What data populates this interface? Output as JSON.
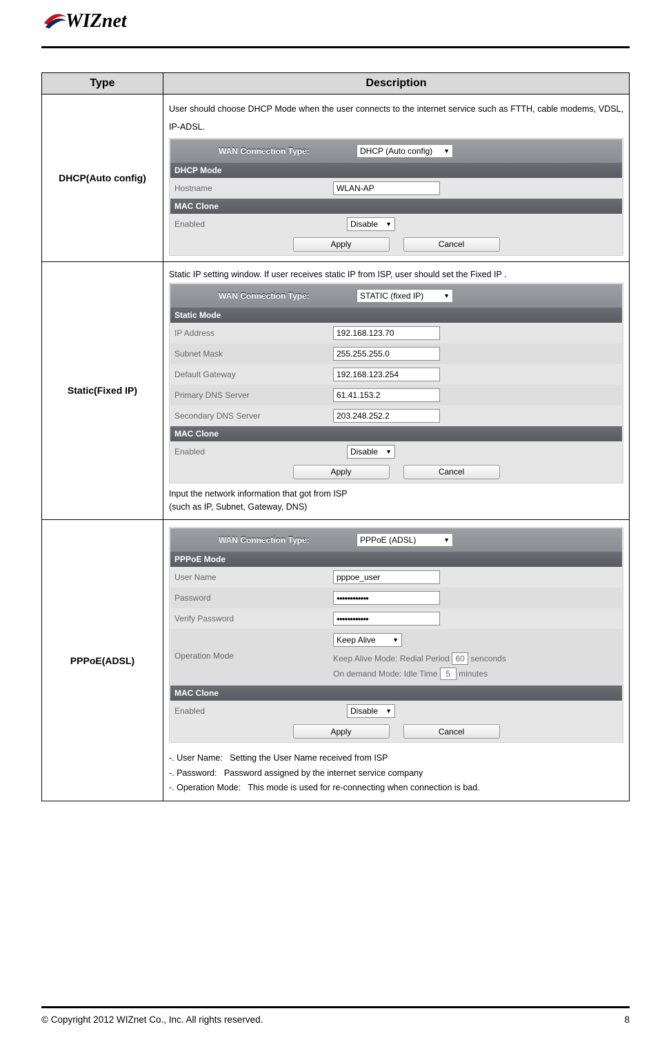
{
  "logo_text": "WIZnet",
  "table": {
    "headers": {
      "type": "Type",
      "description": "Description"
    },
    "rows": {
      "dhcp": {
        "type": "DHCP(Auto config)",
        "desc": "User should choose DHCP Mode when the user connects to the internet service such as FTTH, cable modems, VDSL, IP-ADSL."
      },
      "static": {
        "type": "Static(Fixed IP)",
        "desc": "Static IP setting window. If user receives static IP from ISP, user should set the Fixed IP .",
        "note1": "Input the network information that got from ISP",
        "note2": "(such as IP, Subnet, Gateway, DNS)"
      },
      "pppoe": {
        "type": "PPPoE(ADSL)",
        "n1_label": "-. User Name:",
        "n1_text": "Setting the User Name received from ISP",
        "n2_label": "-. Password:",
        "n2_text": "Password assigned by the internet service company",
        "n3_label": "-. Operation Mode:",
        "n3_text": "This mode is used for re-connecting when connection is bad."
      }
    }
  },
  "panel_common": {
    "wan_label": "WAN Connection Type:",
    "hostname_label": "Hostname",
    "mac_clone_header": "MAC Clone",
    "enabled_label": "Enabled",
    "apply": "Apply",
    "cancel": "Cancel",
    "disable": "Disable"
  },
  "panel_dhcp": {
    "wan_value": "DHCP (Auto config)",
    "mode_header": "DHCP Mode",
    "hostname_value": "WLAN-AP"
  },
  "panel_static": {
    "wan_value": "STATIC (fixed IP)",
    "mode_header": "Static Mode",
    "ip_label": "IP Address",
    "ip_value": "192.168.123.70",
    "subnet_label": "Subnet Mask",
    "subnet_value": "255.255.255.0",
    "gw_label": "Default Gateway",
    "gw_value": "192.168.123.254",
    "dns1_label": "Primary DNS Server",
    "dns1_value": "61.41.153.2",
    "dns2_label": "Secondary DNS Server",
    "dns2_value": "203.248.252.2"
  },
  "panel_pppoe": {
    "wan_value": "PPPoE (ADSL)",
    "mode_header": "PPPoE Mode",
    "user_label": "User Name",
    "user_value": "pppoe_user",
    "pw_label": "Password",
    "pw_value": "●●●●●●●●●●●●",
    "vpw_label": "Verify Password",
    "vpw_value": "●●●●●●●●●●●●",
    "op_label": "Operation Mode",
    "op_value": "Keep Alive",
    "keep_alive_prefix": "Keep Alive Mode: Redial Period",
    "keep_alive_value": "60",
    "keep_alive_suffix": "senconds",
    "ondemand_prefix": "On demand Mode: Idle Time",
    "ondemand_value": "5",
    "ondemand_suffix": "minutes"
  },
  "footer": {
    "copyright": "© Copyright 2012 WIZnet Co., Inc. All rights reserved.",
    "page": "8"
  }
}
